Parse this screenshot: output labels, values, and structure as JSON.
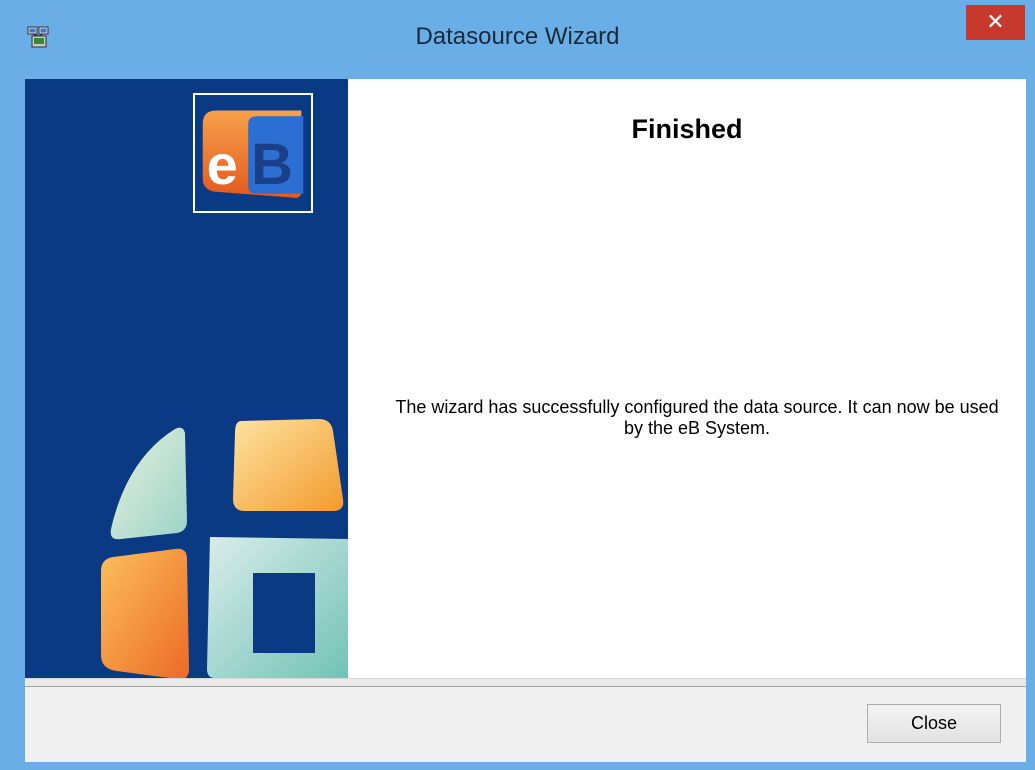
{
  "window": {
    "title": "Datasource Wizard",
    "close_glyph": "✕",
    "app_icon": "computer-network-icon"
  },
  "side_panel": {
    "logo": "eB",
    "background_color": "#0b3a85"
  },
  "main": {
    "heading": "Finished",
    "message": "The wizard has successfully configured the data source. It can now be used by the eB System."
  },
  "footer": {
    "close_label": "Close"
  },
  "colors": {
    "titlebar": "#6aaee8",
    "close_button": "#c7392d",
    "panel_blue": "#0b3a85",
    "orange": "#f47b2a",
    "teal": "#86c9c0"
  }
}
